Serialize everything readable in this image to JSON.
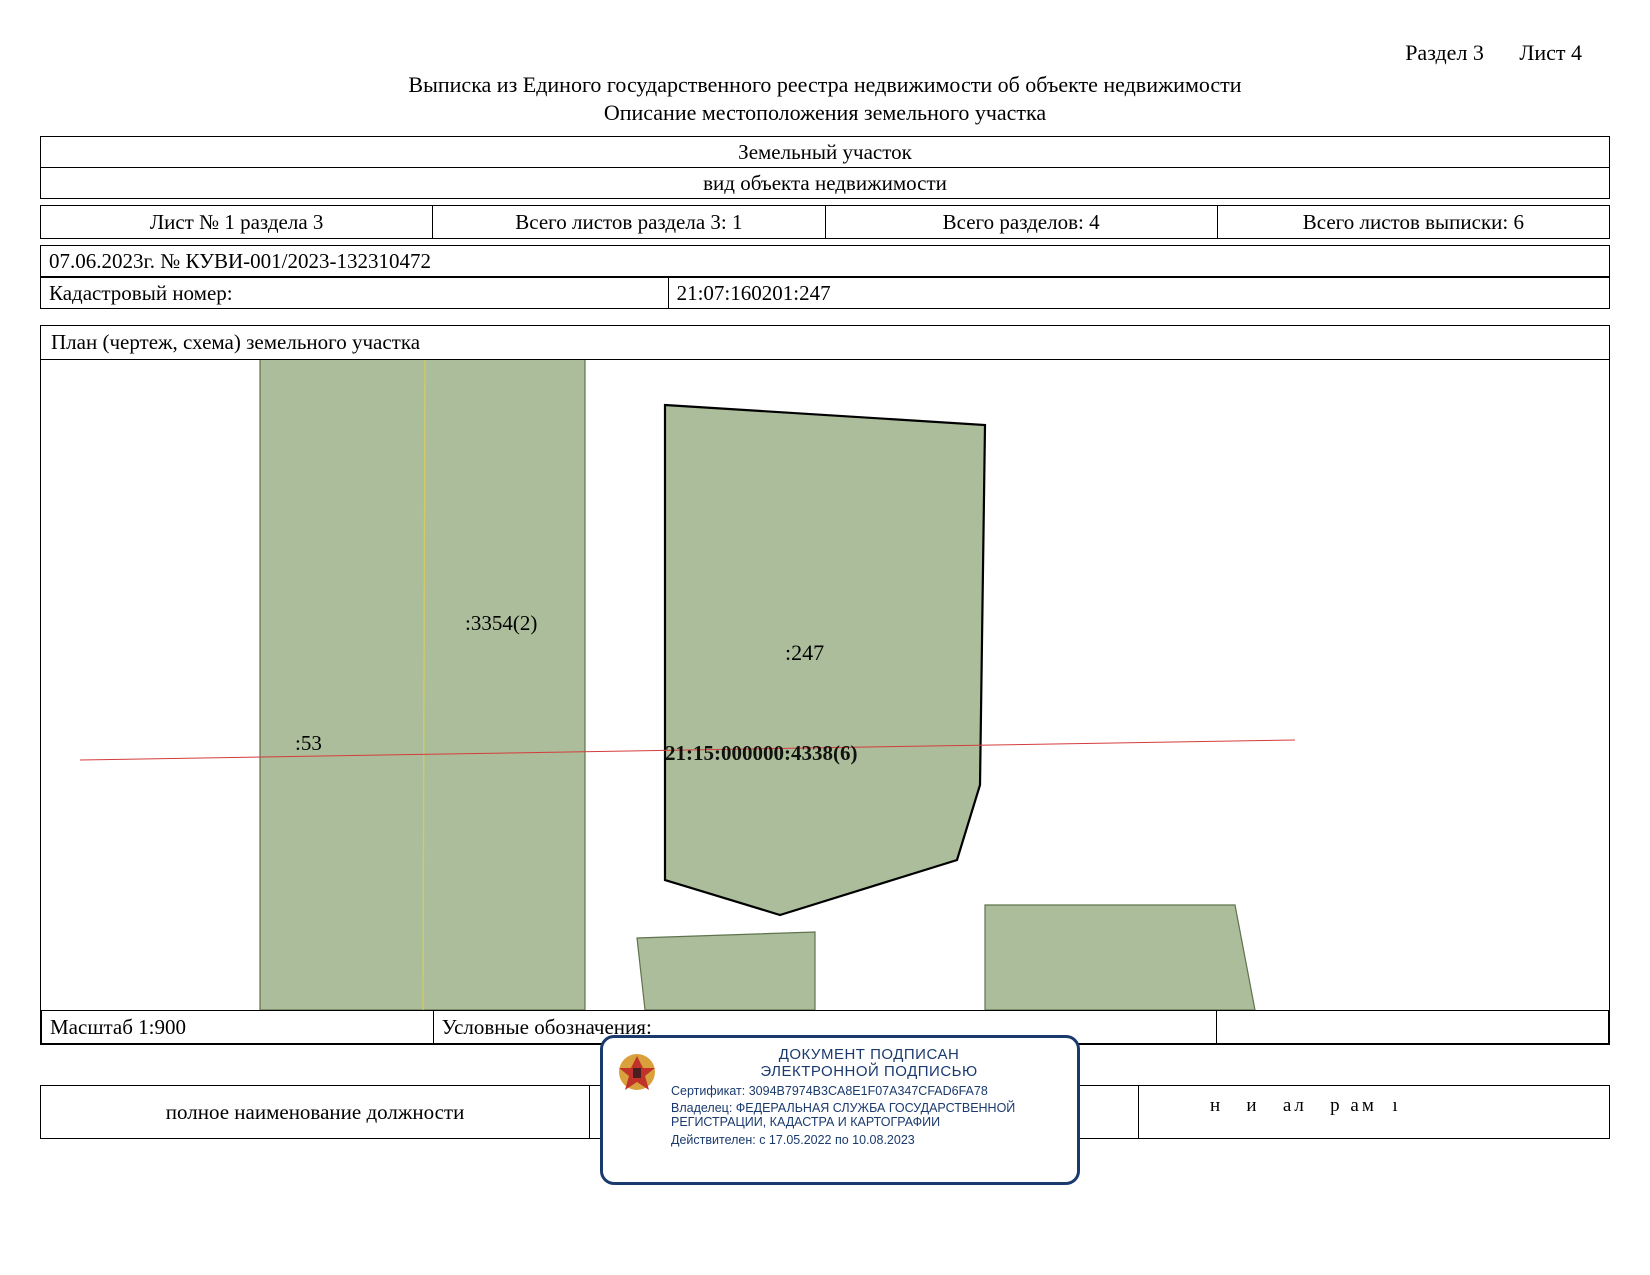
{
  "header": {
    "section_label": "Раздел 3",
    "sheet_label": "Лист 4"
  },
  "title1": "Выписка из Единого государственного реестра недвижимости об объекте недвижимости",
  "title2": "Описание местоположения земельного участка",
  "object_name": "Земельный участок",
  "object_kind": "вид объекта недвижимости",
  "counts": {
    "sheet_of_section": "Лист № 1 раздела 3",
    "total_section_sheets": "Всего листов раздела 3: 1",
    "total_sections": "Всего разделов: 4",
    "total_sheets": "Всего листов выписки: 6"
  },
  "reference": "07.06.2023г. № КУВИ-001/2023-132310472",
  "cadastral_label": "Кадастровый номер:",
  "cadastral_number": "21:07:160201:247",
  "plan": {
    "heading": "План (чертеж, схема) земельного участка",
    "labels": {
      "left_parcel": ":53",
      "mid_parcel": ":3354(2)",
      "main_parcel": ":247",
      "line_label": "21:15:000000:4338(6)"
    }
  },
  "scale_label": "Масштаб 1:900",
  "legend_label": "Условные обозначения:",
  "footer": {
    "position_label": "полное наименование должности",
    "right_marks": "н   и   ал   р ам  ı"
  },
  "stamp": {
    "line1": "ДОКУМЕНТ ПОДПИСАН",
    "line2": "ЭЛЕКТРОННОЙ ПОДПИСЬЮ",
    "cert": "Сертификат: 3094B7974B3CA8E1F07A347CFAD6FA78",
    "owner": "Владелец: ФЕДЕРАЛЬНАЯ СЛУЖБА ГОСУДАРСТВЕННОЙ РЕГИСТРАЦИИ, КАДАСТРА И КАРТОГРАФИИ",
    "valid": "Действителен: с 17.05.2022 по 10.08.2023"
  }
}
